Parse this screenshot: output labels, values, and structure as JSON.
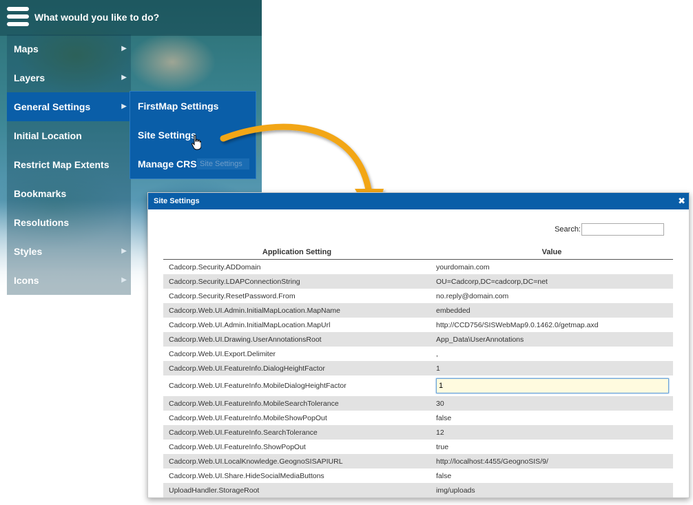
{
  "menu": {
    "title": "What would you like to do?",
    "items": [
      {
        "label": "Maps",
        "has_submenu": true
      },
      {
        "label": "Layers",
        "has_submenu": true
      },
      {
        "label": "General Settings",
        "has_submenu": true,
        "active": true
      },
      {
        "label": "Initial Location",
        "has_submenu": false
      },
      {
        "label": "Restrict Map Extents",
        "has_submenu": false
      },
      {
        "label": "Bookmarks",
        "has_submenu": false
      },
      {
        "label": "Resolutions",
        "has_submenu": false
      },
      {
        "label": "Styles",
        "has_submenu": true
      },
      {
        "label": "Icons",
        "has_submenu": true
      }
    ]
  },
  "submenu": {
    "items": [
      {
        "label": "FirstMap Settings"
      },
      {
        "label": "Site Settings"
      },
      {
        "label": "Manage CRS"
      }
    ],
    "ghost_label": "Site Settings"
  },
  "dialog": {
    "title": "Site Settings",
    "close_glyph": "✖",
    "search_label": "Search:",
    "search_value": "",
    "columns": [
      "Application Setting",
      "Value"
    ],
    "rows": [
      {
        "setting": "Cadcorp.Security.ADDomain",
        "value": "yourdomain.com"
      },
      {
        "setting": "Cadcorp.Security.LDAPConnectionString",
        "value": "OU=Cadcorp,DC=cadcorp,DC=net"
      },
      {
        "setting": "Cadcorp.Security.ResetPassword.From",
        "value": "no.reply@domain.com"
      },
      {
        "setting": "Cadcorp.Web.UI.Admin.InitialMapLocation.MapName",
        "value": "embedded"
      },
      {
        "setting": "Cadcorp.Web.UI.Admin.InitialMapLocation.MapUrl",
        "value": "http://CCD756/SISWebMap9.0.1462.0/getmap.axd"
      },
      {
        "setting": "Cadcorp.Web.UI.Drawing.UserAnnotationsRoot",
        "value": "App_Data\\UserAnnotations"
      },
      {
        "setting": "Cadcorp.Web.UI.Export.Delimiter",
        "value": ","
      },
      {
        "setting": "Cadcorp.Web.UI.FeatureInfo.DialogHeightFactor",
        "value": "1"
      },
      {
        "setting": "Cadcorp.Web.UI.FeatureInfo.MobileDialogHeightFactor",
        "value": "1",
        "editing": true
      },
      {
        "setting": "Cadcorp.Web.UI.FeatureInfo.MobileSearchTolerance",
        "value": "30"
      },
      {
        "setting": "Cadcorp.Web.UI.FeatureInfo.MobileShowPopOut",
        "value": "false"
      },
      {
        "setting": "Cadcorp.Web.UI.FeatureInfo.SearchTolerance",
        "value": "12"
      },
      {
        "setting": "Cadcorp.Web.UI.FeatureInfo.ShowPopOut",
        "value": "true"
      },
      {
        "setting": "Cadcorp.Web.UI.LocalKnowledge.GeognoSISAPIURL",
        "value": "http://localhost:4455/GeognoSIS/9/"
      },
      {
        "setting": "Cadcorp.Web.UI.Share.HideSocialMediaButtons",
        "value": "false"
      },
      {
        "setting": "UploadHandler.StorageRoot",
        "value": "img/uploads"
      }
    ]
  },
  "colors": {
    "accent": "#0a5ea8",
    "arrow": "#f2a619",
    "row_alt": "#e2e2e2",
    "edit_bg": "#fffbdf"
  },
  "icons": {
    "menu": "hamburger-icon",
    "chevron": "chevron-right-icon",
    "cursor": "hand-pointer-icon",
    "close": "close-icon"
  }
}
